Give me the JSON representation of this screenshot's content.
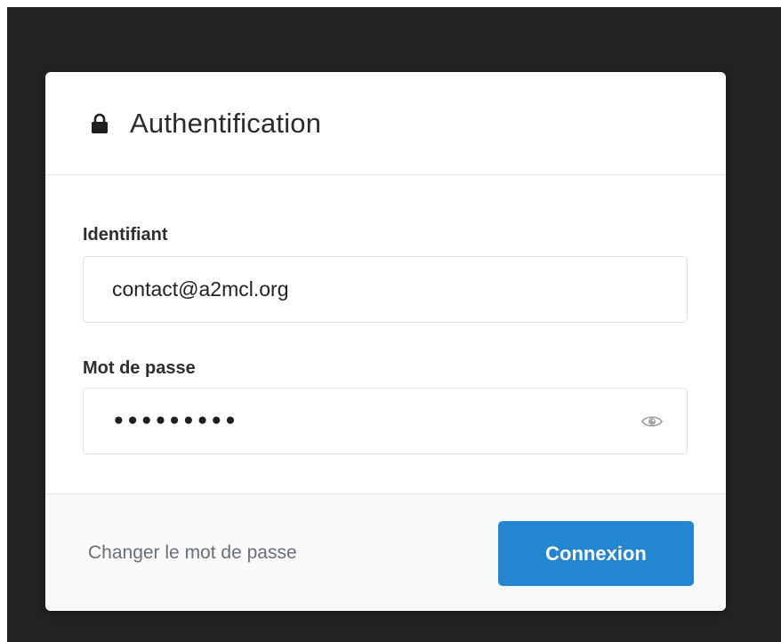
{
  "dialog": {
    "title": "Authentification",
    "icon": "lock-icon"
  },
  "form": {
    "username": {
      "label": "Identifiant",
      "value": "contact@a2mcl.org"
    },
    "password": {
      "label": "Mot de passe",
      "masked_value": "•••••••••",
      "toggle_icon": "eye-icon"
    }
  },
  "footer": {
    "change_password_label": "Changer le mot de passe",
    "submit_label": "Connexion"
  },
  "colors": {
    "primary": "#2486d1",
    "backdrop": "#232323",
    "footer_bg": "#f6f8fa"
  }
}
